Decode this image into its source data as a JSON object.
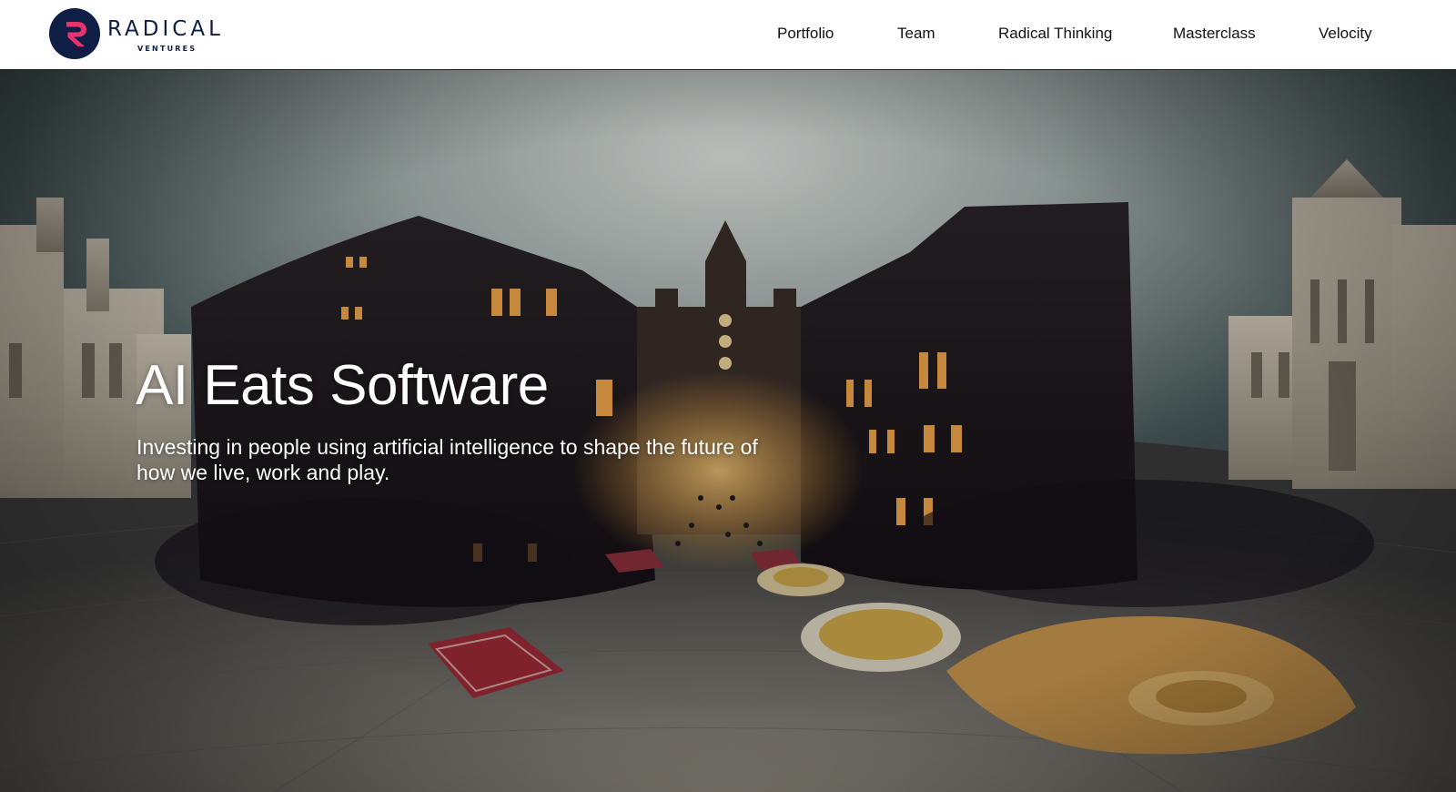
{
  "brand": {
    "name": "RADICAL",
    "tagline": "VENTURES",
    "logo_icon": "radical-r-logo-icon",
    "primary_color": "#0f1e45",
    "accent_color": "#e8336d"
  },
  "nav": {
    "items": [
      {
        "label": "Portfolio"
      },
      {
        "label": "Team"
      },
      {
        "label": "Radical Thinking"
      },
      {
        "label": "Masterclass"
      },
      {
        "label": "Velocity"
      }
    ]
  },
  "hero": {
    "title": "AI Eats Software",
    "subtitle": "Investing in people using artificial intelligence to shape the future of how we live, work and play.",
    "background": "panoramic-fantasy-city-street-image"
  }
}
